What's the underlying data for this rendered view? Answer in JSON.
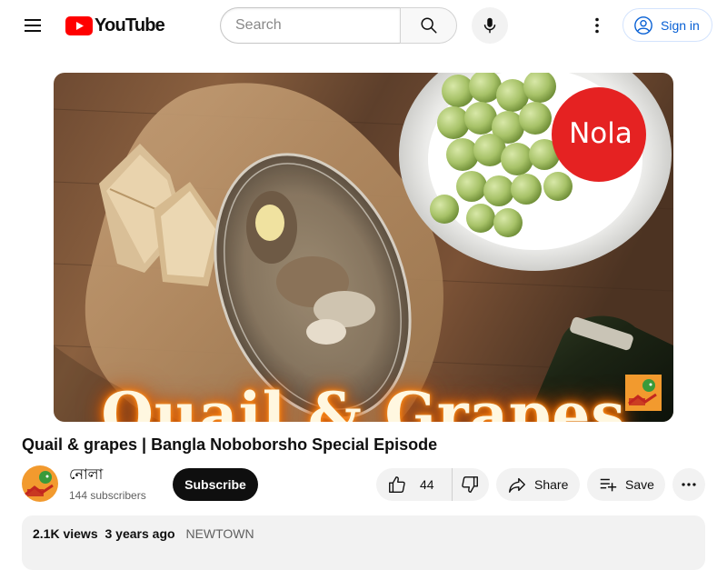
{
  "header": {
    "logo_text": "YouTube",
    "search_placeholder": "Search",
    "signin_label": "Sign in"
  },
  "player": {
    "thumbnail_title": "Quail & Grapes",
    "badge_text": "Nola"
  },
  "video": {
    "title": "Quail & grapes | Bangla Noboborsho Special Episode"
  },
  "channel": {
    "name": "নোলা",
    "subscribers": "144 subscribers",
    "subscribe_label": "Subscribe"
  },
  "actions": {
    "like_count": "44",
    "share_label": "Share",
    "save_label": "Save"
  },
  "description": {
    "views": "2.1K views",
    "age": "3 years ago",
    "hashtag": "NEWTOWN"
  },
  "colors": {
    "brand_red": "#ff0000",
    "link_blue": "#065fd4",
    "badge_red": "#e52222"
  }
}
